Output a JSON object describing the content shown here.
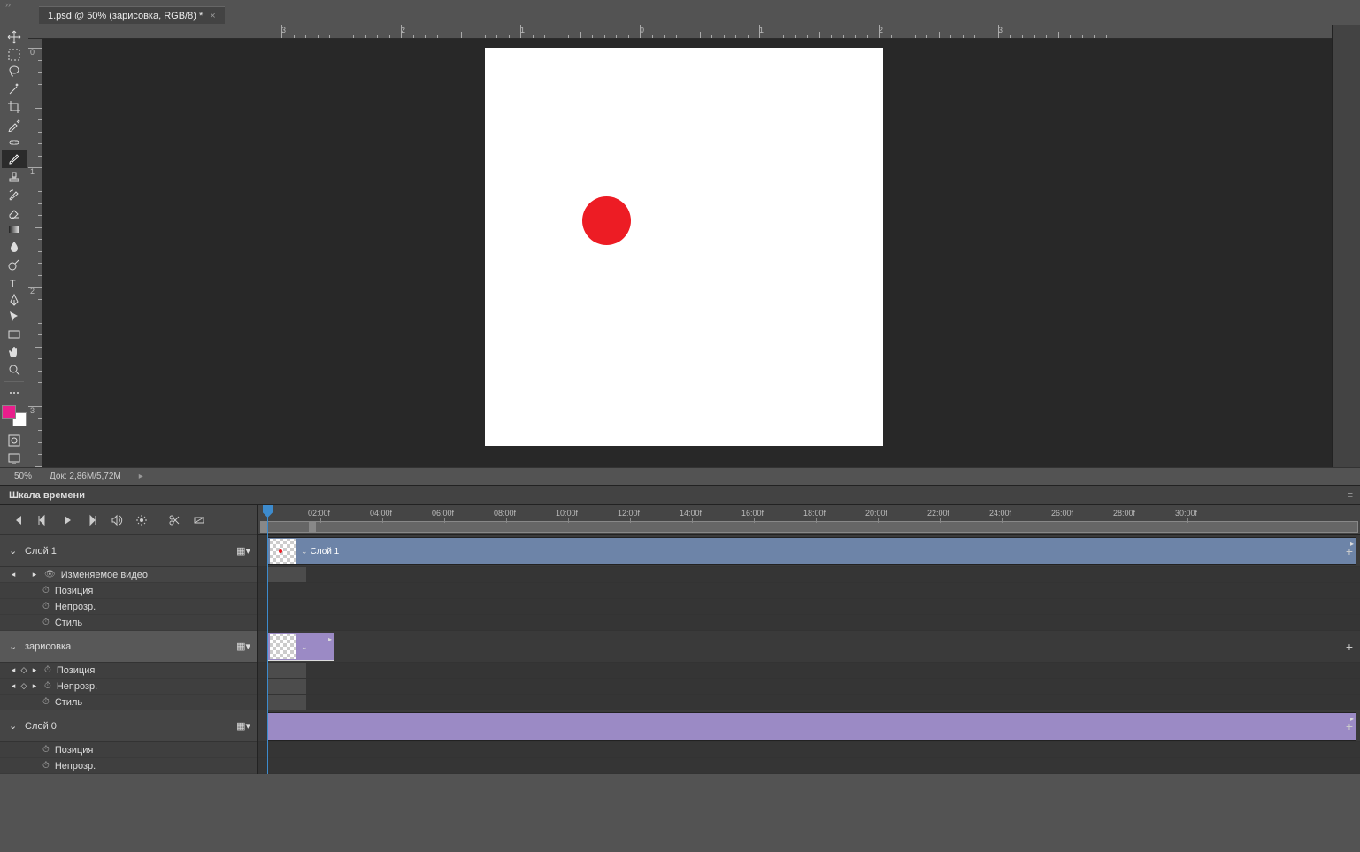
{
  "tab": {
    "title": "1.psd @ 50% (зарисовка, RGB/8) *"
  },
  "statusbar": {
    "zoom": "50%",
    "doc": "Док: 2,86M/5,72M"
  },
  "timeline": {
    "title": "Шкала времени",
    "ruler": [
      "02:00f",
      "04:00f",
      "06:00f",
      "08:00f",
      "10:00f",
      "12:00f",
      "14:00f",
      "16:00f",
      "18:00f",
      "20:00f",
      "22:00f",
      "24:00f",
      "26:00f",
      "28:00f",
      "30:00f"
    ],
    "tracks": [
      {
        "name": "Слой 1",
        "clip_name": "Слой 1",
        "props_hdr": "Изменяемое видео",
        "props": [
          "Позиция",
          "Непрозр.",
          "Стиль"
        ]
      },
      {
        "name": "зарисовка",
        "props": [
          "Позиция",
          "Непрозр.",
          "Стиль"
        ]
      },
      {
        "name": "Слой 0",
        "props": [
          "Позиция",
          "Непрозр."
        ]
      }
    ]
  },
  "ruler_h": [
    "3",
    "2",
    "1",
    "0",
    "1",
    "2",
    "3"
  ],
  "ruler_v": [
    "0",
    "1",
    "2",
    "3"
  ]
}
